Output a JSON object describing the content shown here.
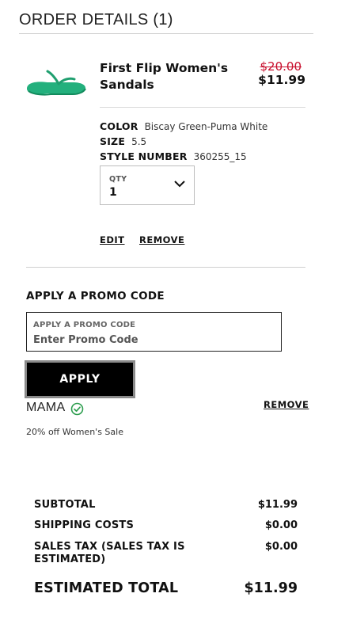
{
  "header": {
    "title": "ORDER DETAILS (1)"
  },
  "item": {
    "name": "First Flip Women's Sandals",
    "price_original": "$20.00",
    "price_sale": "$11.99",
    "image_icon": "green-flip-flop-sandal",
    "attributes": [
      {
        "label": "COLOR",
        "value": "Biscay Green-Puma White"
      },
      {
        "label": "SIZE",
        "value": "5.5"
      },
      {
        "label": "STYLE NUMBER",
        "value": "360255_15"
      }
    ],
    "qty": {
      "label": "QTY",
      "value": "1"
    },
    "actions": {
      "edit": "EDIT",
      "remove": "REMOVE"
    }
  },
  "promo": {
    "heading": "APPLY A PROMO CODE",
    "field_label": "APPLY A PROMO CODE",
    "placeholder": "Enter Promo Code",
    "apply_label": "APPLY",
    "applied_code": "MAMA",
    "applied_icon": "check-circle-icon",
    "remove_label": "REMOVE",
    "description": "20% off Women's Sale",
    "accent_color": "#2e9e4f"
  },
  "summary": {
    "subtotal": {
      "label": "SUBTOTAL",
      "value": "$11.99"
    },
    "shipping": {
      "label": "SHIPPING COSTS",
      "value": "$0.00"
    },
    "tax": {
      "label": "SALES TAX (SALES TAX IS ESTIMATED)",
      "value": "$0.00"
    },
    "total": {
      "label": "ESTIMATED TOTAL",
      "value": "$11.99"
    }
  },
  "colors": {
    "sale_price_strike": "#c8102e",
    "button_bg": "#000000",
    "sandal": "#23b07d"
  }
}
